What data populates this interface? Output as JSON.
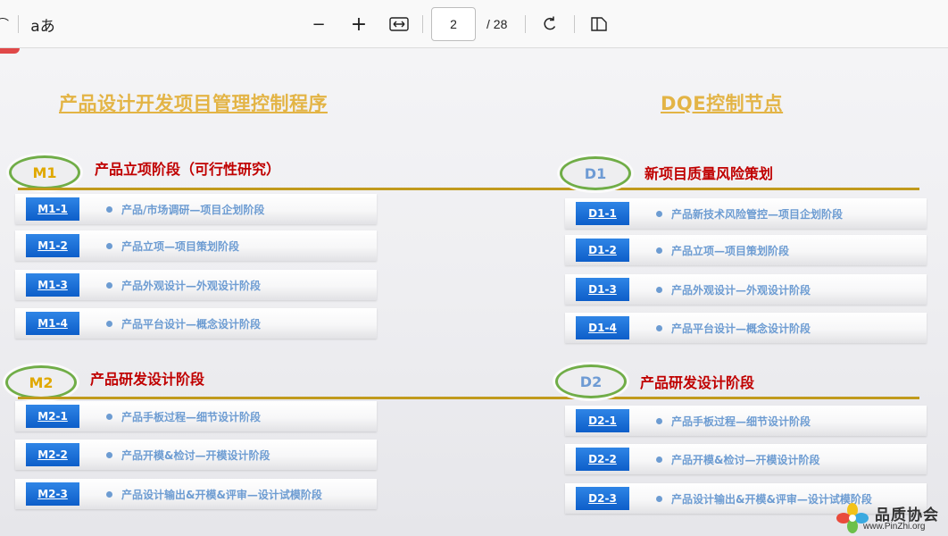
{
  "toolbar": {
    "text_mode_label": "aあ",
    "zoom_out_glyph": "−",
    "zoom_in_glyph": "+",
    "current_page": "2",
    "page_total": "/ 28",
    "icons": [
      "text-mode-icon",
      "zoom-out-icon",
      "zoom-in-icon",
      "fit-width-icon",
      "rotate-icon",
      "page-view-icon"
    ]
  },
  "slide": {
    "left_heading": "产品设计开发项目管理控制程序",
    "right_heading": "DQE控制节点",
    "left_groups": [
      {
        "badge": "M1",
        "title": "产品立项阶段（可行性研究）",
        "rows": [
          {
            "code": "M1-1",
            "text": "产品/市场调研—项目企划阶段"
          },
          {
            "code": "M1-2",
            "text": "产品立项—项目策划阶段"
          },
          {
            "code": "M1-3",
            "text": "产品外观设计—外观设计阶段"
          },
          {
            "code": "M1-4",
            "text": "产品平台设计—概念设计阶段"
          }
        ]
      },
      {
        "badge": "M2",
        "title": "产品研发设计阶段",
        "rows": [
          {
            "code": "M2-1",
            "text": "产品手板过程—细节设计阶段"
          },
          {
            "code": "M2-2",
            "text": "产品开模&检讨—开模设计阶段"
          },
          {
            "code": "M2-3",
            "text": "产品设计输出&开模&评审—设计试模阶段"
          }
        ]
      }
    ],
    "right_groups": [
      {
        "badge": "D1",
        "title": "新项目质量风险策划",
        "rows": [
          {
            "code": "D1-1",
            "text": "产品新技术风险管控—项目企划阶段"
          },
          {
            "code": "D1-2",
            "text": "产品立项—项目策划阶段"
          },
          {
            "code": "D1-3",
            "text": "产品外观设计—外观设计阶段"
          },
          {
            "code": "D1-4",
            "text": "产品平台设计—概念设计阶段"
          }
        ]
      },
      {
        "badge": "D2",
        "title": "产品研发设计阶段",
        "rows": [
          {
            "code": "D2-1",
            "text": "产品手板过程—细节设计阶段"
          },
          {
            "code": "D2-2",
            "text": "产品开模&检讨—开模设计阶段"
          },
          {
            "code": "D2-3",
            "text": "产品设计输出&开模&评审—设计试模阶段"
          }
        ]
      }
    ]
  },
  "watermark": {
    "name": "品质协会",
    "url": "www.PinZhi.org"
  },
  "colors": {
    "heading_gold": "#e3b445",
    "divider_gold": "#c19a1c",
    "phase_red": "#c00000",
    "badge_green": "#70ad47",
    "code_blue": "#1a6fd6",
    "row_text_blue": "#6d9cd2"
  }
}
